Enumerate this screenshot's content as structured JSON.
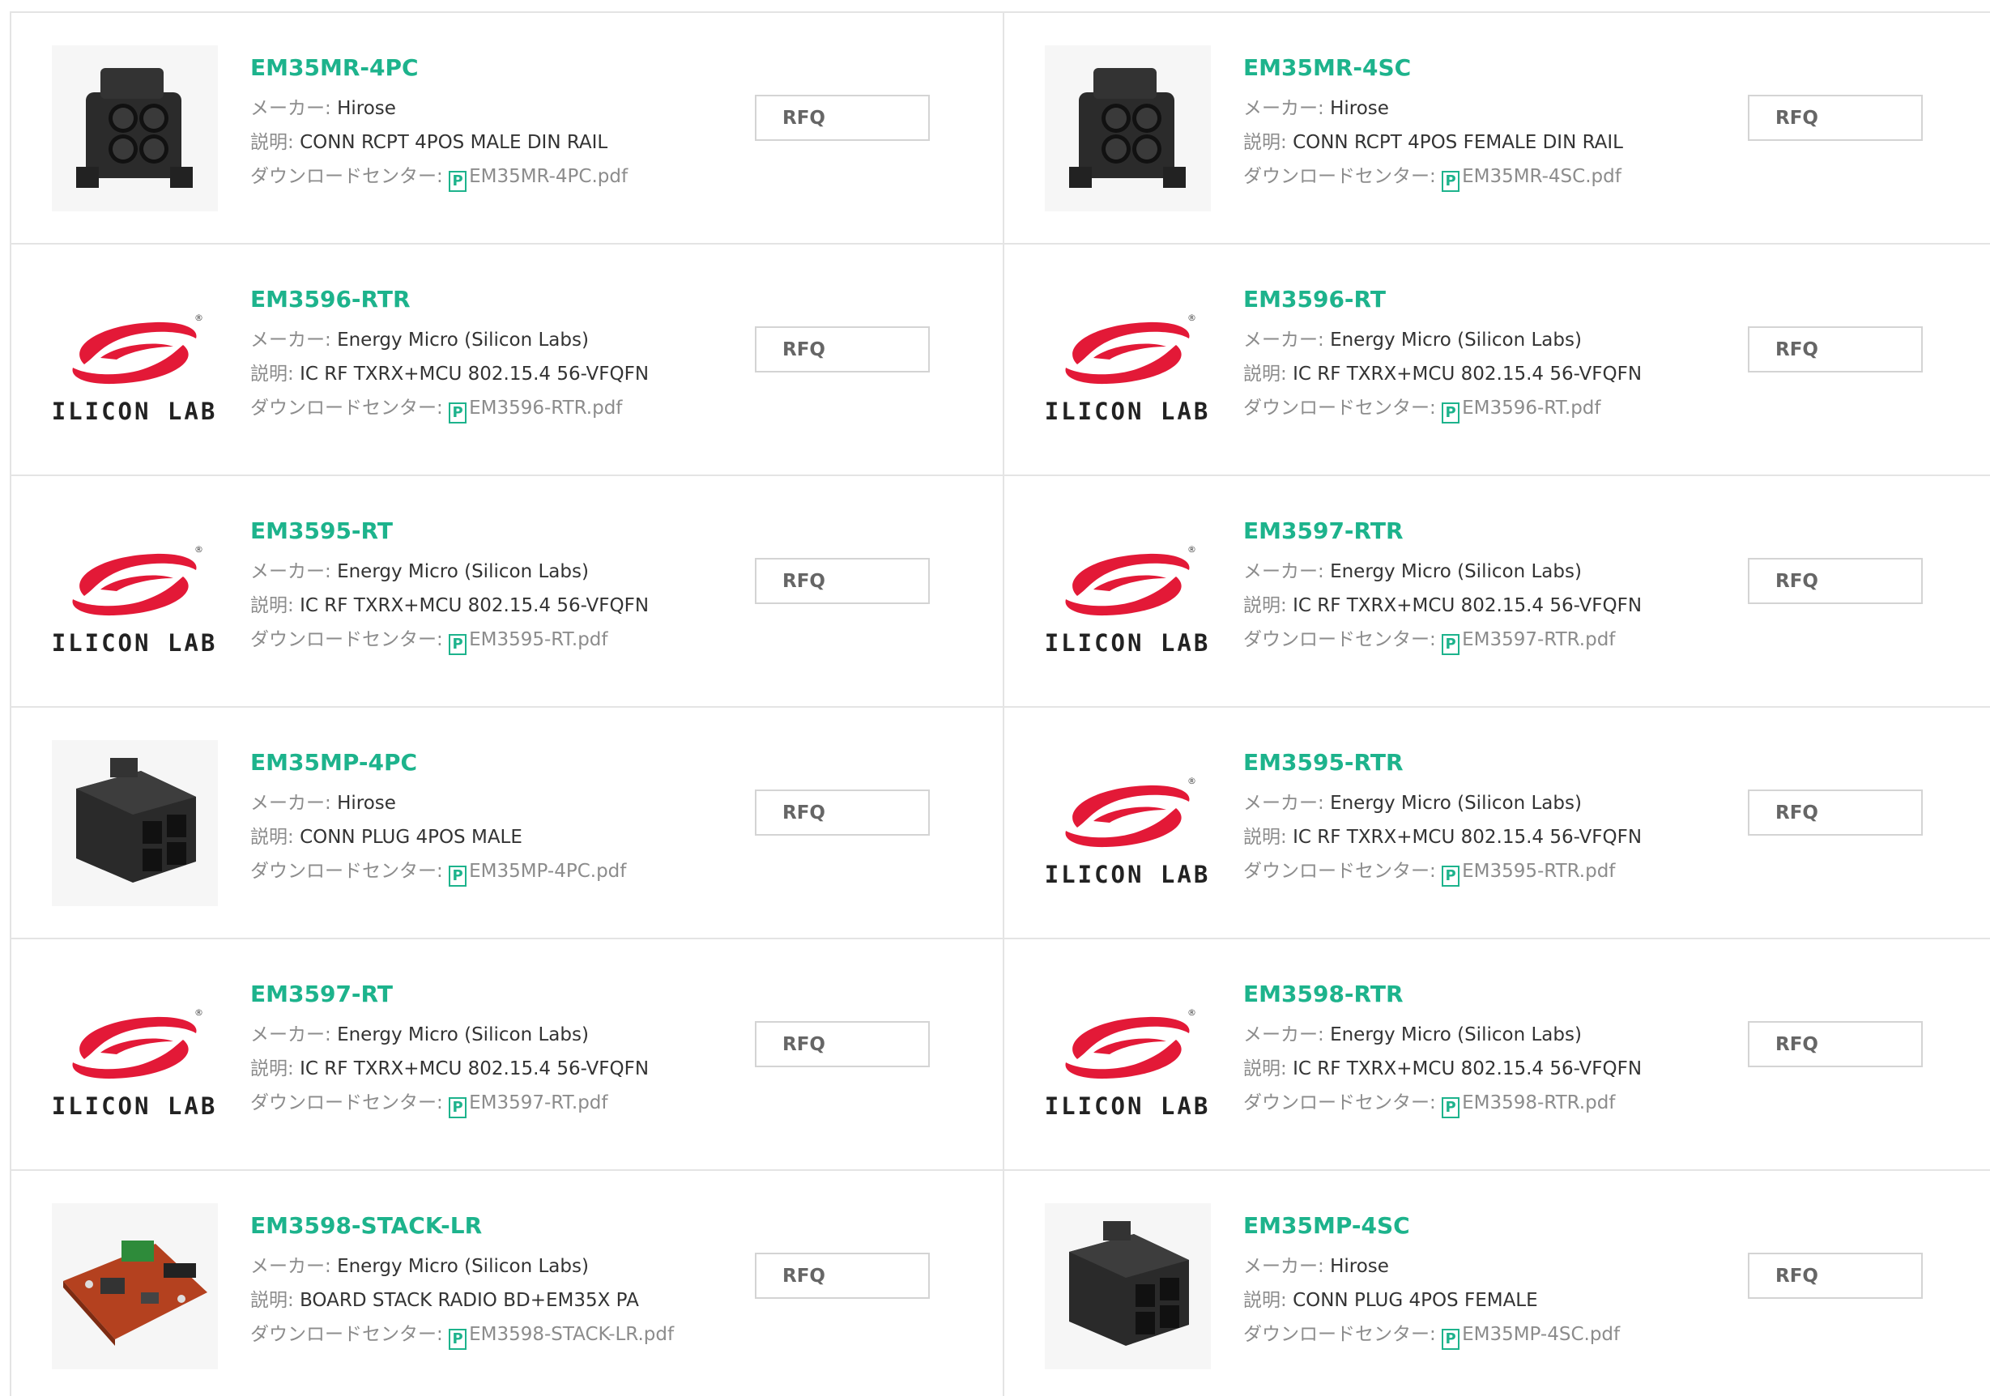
{
  "labels": {
    "maker": "メーカー: ",
    "description": "説明: ",
    "download": "ダウンロードセンター: ",
    "pdf_icon_glyph": "P",
    "rfq": "RFQ"
  },
  "colors": {
    "accent": "#1db38c",
    "label": "#8c8c8c",
    "text": "#333333",
    "border": "#e4e4e4",
    "logo_red": "#e31937"
  },
  "products": [
    {
      "part": "EM35MR-4PC",
      "maker": "Hirose",
      "desc": "CONN RCPT 4POS MALE DIN RAIL",
      "pdf": "EM35MR-4PC.pdf",
      "image": "connector-receptacle"
    },
    {
      "part": "EM35MR-4SC",
      "maker": "Hirose",
      "desc": "CONN RCPT 4POS FEMALE DIN RAIL",
      "pdf": "EM35MR-4SC.pdf",
      "image": "connector-receptacle"
    },
    {
      "part": "EM3596-RTR",
      "maker": "Energy Micro (Silicon Labs)",
      "desc": "IC RF TXRX+MCU 802.15.4 56-VFQFN",
      "pdf": "EM3596-RTR.pdf",
      "image": "silicon-labs-logo"
    },
    {
      "part": "EM3596-RT",
      "maker": "Energy Micro (Silicon Labs)",
      "desc": "IC RF TXRX+MCU 802.15.4 56-VFQFN",
      "pdf": "EM3596-RT.pdf",
      "image": "silicon-labs-logo"
    },
    {
      "part": "EM3595-RT",
      "maker": "Energy Micro (Silicon Labs)",
      "desc": "IC RF TXRX+MCU 802.15.4 56-VFQFN",
      "pdf": "EM3595-RT.pdf",
      "image": "silicon-labs-logo"
    },
    {
      "part": "EM3597-RTR",
      "maker": "Energy Micro (Silicon Labs)",
      "desc": "IC RF TXRX+MCU 802.15.4 56-VFQFN",
      "pdf": "EM3597-RTR.pdf",
      "image": "silicon-labs-logo"
    },
    {
      "part": "EM35MP-4PC",
      "maker": "Hirose",
      "desc": "CONN PLUG 4POS MALE",
      "pdf": "EM35MP-4PC.pdf",
      "image": "connector-plug"
    },
    {
      "part": "EM3595-RTR",
      "maker": "Energy Micro (Silicon Labs)",
      "desc": "IC RF TXRX+MCU 802.15.4 56-VFQFN",
      "pdf": "EM3595-RTR.pdf",
      "image": "silicon-labs-logo"
    },
    {
      "part": "EM3597-RT",
      "maker": "Energy Micro (Silicon Labs)",
      "desc": "IC RF TXRX+MCU 802.15.4 56-VFQFN",
      "pdf": "EM3597-RT.pdf",
      "image": "silicon-labs-logo"
    },
    {
      "part": "EM3598-RTR",
      "maker": "Energy Micro (Silicon Labs)",
      "desc": "IC RF TXRX+MCU 802.15.4 56-VFQFN",
      "pdf": "EM3598-RTR.pdf",
      "image": "silicon-labs-logo"
    },
    {
      "part": "EM3598-STACK-LR",
      "maker": "Energy Micro (Silicon Labs)",
      "desc": "BOARD STACK RADIO BD+EM35X PA",
      "pdf": "EM3598-STACK-LR.pdf",
      "image": "dev-board"
    },
    {
      "part": "EM35MP-4SC",
      "maker": "Hirose",
      "desc": "CONN PLUG 4POS FEMALE",
      "pdf": "EM35MP-4SC.pdf",
      "image": "connector-plug"
    }
  ],
  "logo": {
    "text": "SILICON LABS",
    "mark": "®"
  }
}
